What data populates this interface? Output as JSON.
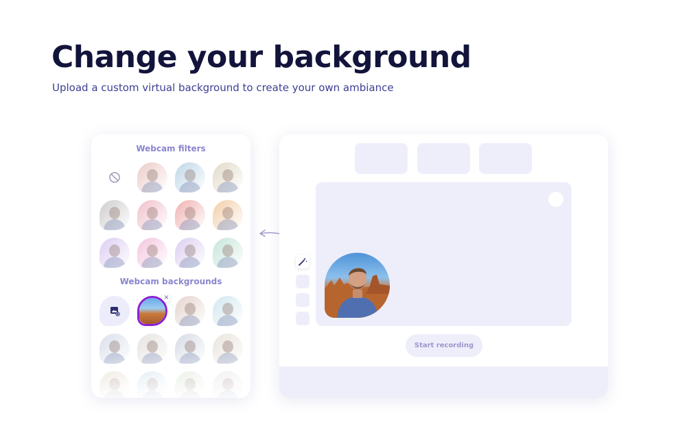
{
  "hero": {
    "title": "Change your background",
    "subtitle": "Upload a custom virtual background to create your own ambiance"
  },
  "panel": {
    "filters_heading": "Webcam filters",
    "backgrounds_heading": "Webcam backgrounds",
    "filters": [
      {
        "icon": "no-filter-icon",
        "tint": "none"
      },
      {
        "tint": "#e9c7c2"
      },
      {
        "tint": "#b9d3e6"
      },
      {
        "tint": "#ded7c3"
      },
      {
        "tint": "#c8c8c8"
      },
      {
        "tint": "#f0b9c6"
      },
      {
        "tint": "#f0a9a9"
      },
      {
        "tint": "#f2c9a0"
      },
      {
        "tint": "#d9c8f2"
      },
      {
        "tint": "#f3bfd9"
      },
      {
        "tint": "#d9c9ef"
      },
      {
        "tint": "#bfe3d6"
      }
    ],
    "backgrounds": [
      {
        "icon": "upload-image-icon"
      },
      {
        "selected": true,
        "remove_label": "×"
      },
      {
        "tint": "#e2cfc8"
      },
      {
        "tint": "#cfe6ef"
      },
      {
        "tint": "#d6dce8"
      },
      {
        "tint": "#e4e0dc"
      },
      {
        "tint": "#d3d8e2"
      },
      {
        "tint": "#e7e2da"
      },
      {
        "tint": "#e2d8c8"
      },
      {
        "tint": "#cfe0ec"
      },
      {
        "tint": "#d8e4d2"
      },
      {
        "tint": "#e4e2e8"
      }
    ]
  },
  "app": {
    "start_button": "Start recording"
  },
  "colors": {
    "accent": "#8b1fd6",
    "muted": "#eeeefb",
    "heading": "#13143b"
  }
}
